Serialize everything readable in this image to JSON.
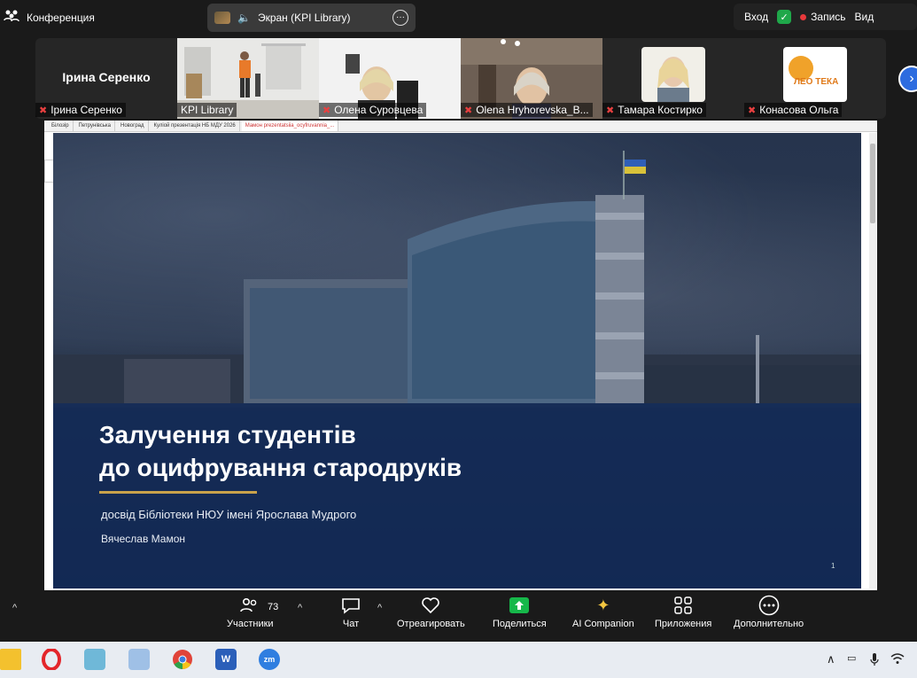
{
  "app": {
    "title": "Конференция"
  },
  "share_pill": {
    "label": "Экран (KPI Library)"
  },
  "top_right": {
    "signin": "Вход",
    "record": "Запись",
    "view": "Вид"
  },
  "participants": [
    {
      "name": "Ірина Серенко",
      "muted": true
    },
    {
      "name": "KPI Library",
      "muted": false
    },
    {
      "name": "Олена Суровцева",
      "muted": true
    },
    {
      "name": "Olena Hryhorevska_В...",
      "muted": true
    },
    {
      "name": "Тамара Костирко",
      "muted": true
    },
    {
      "name": "Конасова Ольга",
      "muted": true
    }
  ],
  "browser_tabs": [
    "Білозір",
    "Петрунівська",
    "Новоград",
    "Куліой презентація НБ МДУ 2026",
    "Мамон prezentatsiia_ocyfruvannia_..."
  ],
  "slide": {
    "title_line1": "Залучення студентів",
    "title_line2": "до оцифрування стародруків",
    "subtitle": "досвід Бібліотеки НЮУ імені Ярослава Мудрого",
    "author": "Вячеслав Мамон",
    "page": "1"
  },
  "toolbar": {
    "participants_label": "Участники",
    "participants_count": "73",
    "chat_label": "Чат",
    "react_label": "Отреагировать",
    "share_label": "Поделиться",
    "ai_label": "AI Companion",
    "apps_label": "Приложения",
    "more_label": "Дополнительно"
  },
  "logo_text": "ЛЕО ТЕКА"
}
